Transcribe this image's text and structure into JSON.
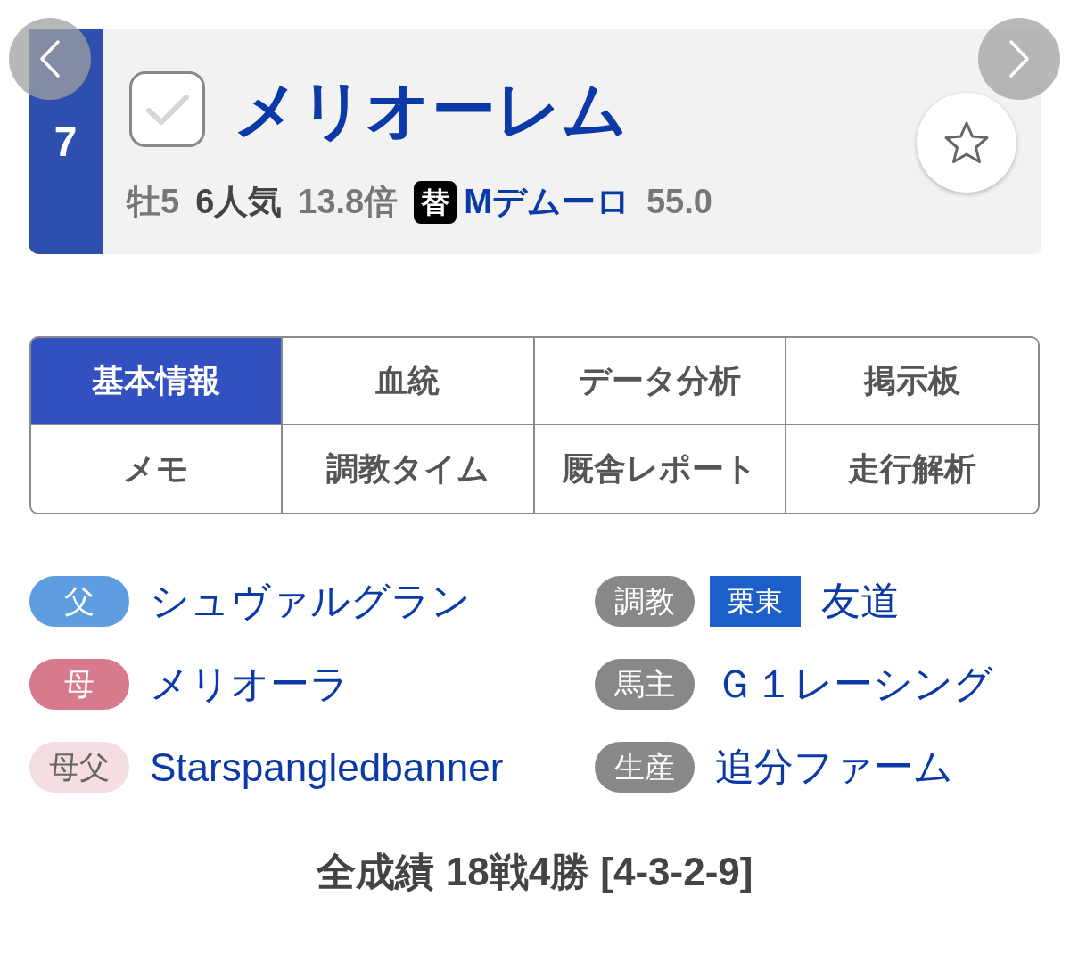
{
  "header": {
    "number": "7",
    "checked": false,
    "name": "メリオーレム",
    "favorite": false,
    "details": {
      "sex_age": "牡5",
      "popularity": "6人気",
      "odds": "13.8倍",
      "jockey_badge": "替",
      "jockey": "Mデムーロ",
      "weight": "55.0"
    }
  },
  "tabs": [
    {
      "label": "基本情報",
      "selected": true
    },
    {
      "label": "血統",
      "selected": false
    },
    {
      "label": "データ分析",
      "selected": false
    },
    {
      "label": "掲示板",
      "selected": false
    },
    {
      "label": "メモ",
      "selected": false
    },
    {
      "label": "調教タイム",
      "selected": false
    },
    {
      "label": "厩舎レポート",
      "selected": false
    },
    {
      "label": "走行解析",
      "selected": false
    }
  ],
  "pedigree": [
    {
      "label": "父",
      "color": "#5d9de0",
      "value": "シュヴァルグラン"
    },
    {
      "label": "母",
      "color": "#d77a8d",
      "value": "メリオーラ"
    },
    {
      "label": "母父",
      "color": "#f5dde2",
      "value": "Starspangledbanner"
    }
  ],
  "connections": [
    {
      "label": "調教",
      "region": "栗東",
      "value": "友道"
    },
    {
      "label": "馬主",
      "value": "Ｇ１レーシング"
    },
    {
      "label": "生産",
      "value": "追分ファーム"
    }
  ],
  "record": "全成績 18戦4勝 [4-3-2-9]"
}
